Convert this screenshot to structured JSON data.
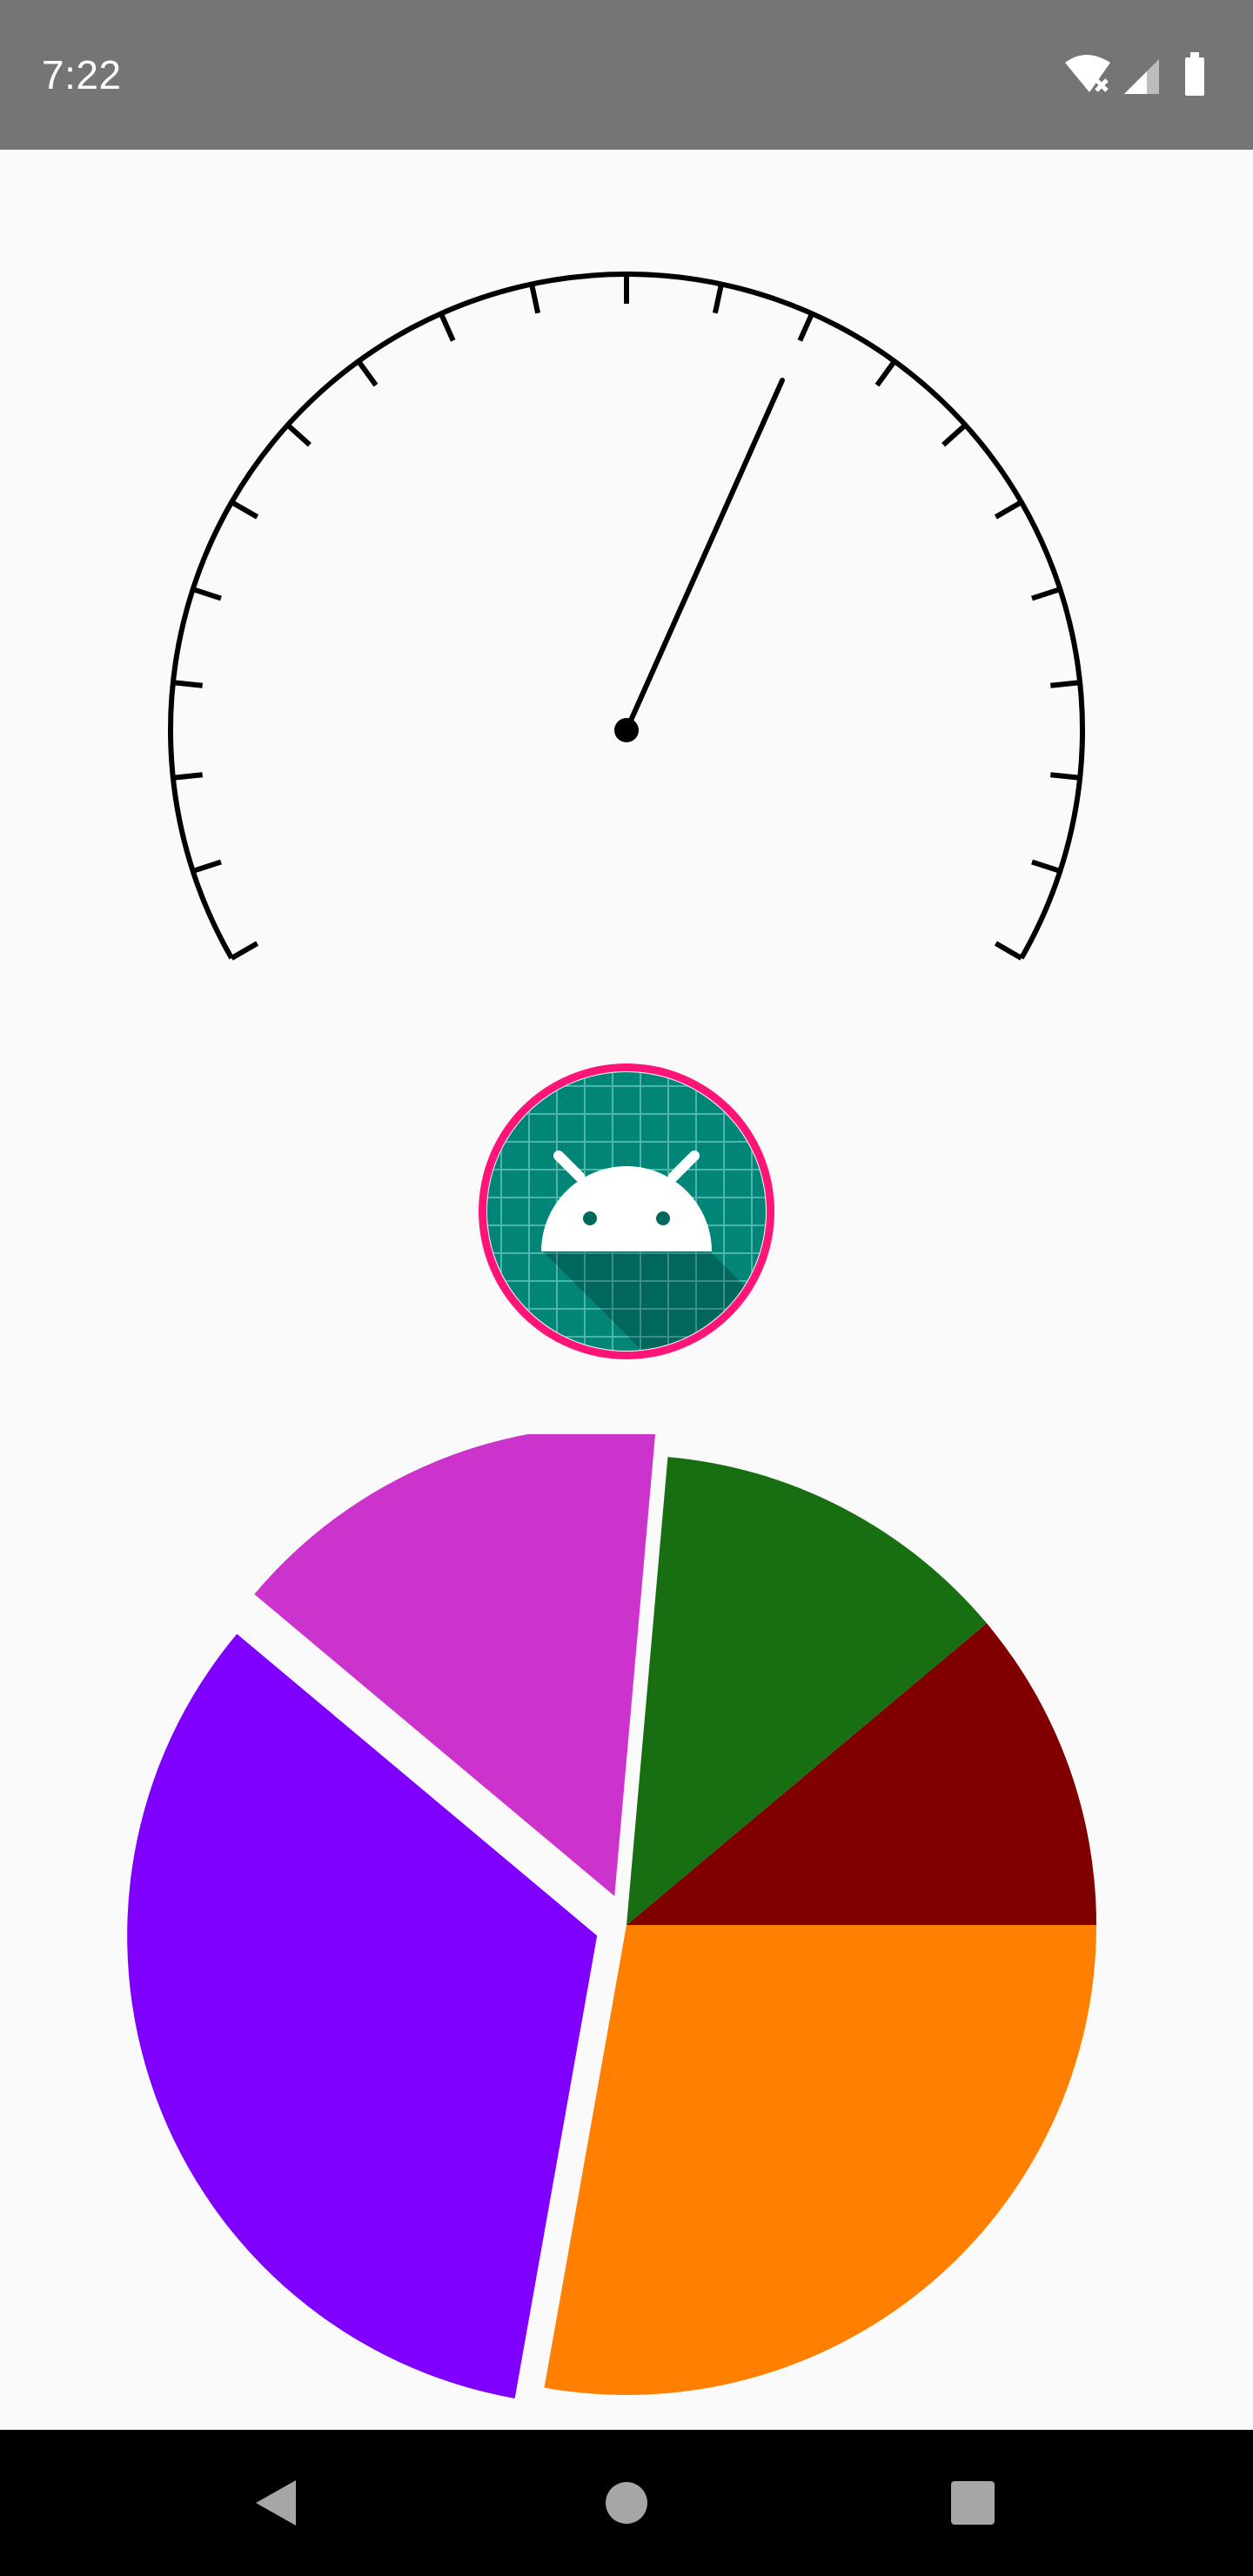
{
  "status_bar": {
    "time": "7:22",
    "background_color": "#757575",
    "icons": [
      "wifi-off-icon",
      "signal-icon",
      "battery-icon"
    ]
  },
  "gauge": {
    "needle_value_fraction": 0.6,
    "tick_count": 21,
    "stroke_color": "#000000"
  },
  "avatar": {
    "icon": "android-icon",
    "border_color": "#ff1478",
    "background_color": "#008577",
    "grid_color": "#4db6ac"
  },
  "chart_data": {
    "type": "pie",
    "slices": [
      {
        "value": 0.111,
        "color": "#800000"
      },
      {
        "value": 0.125,
        "color": "#186f12"
      },
      {
        "value": 0.153,
        "color": "#cc33cc",
        "exploded": true
      },
      {
        "value": 0.333,
        "color": "#8000ff",
        "exploded": true
      },
      {
        "value": 0.278,
        "color": "#ff8000"
      }
    ]
  },
  "nav_bar": {
    "icons": [
      "back-icon",
      "home-icon",
      "recents-icon"
    ],
    "background_color": "#000000"
  }
}
